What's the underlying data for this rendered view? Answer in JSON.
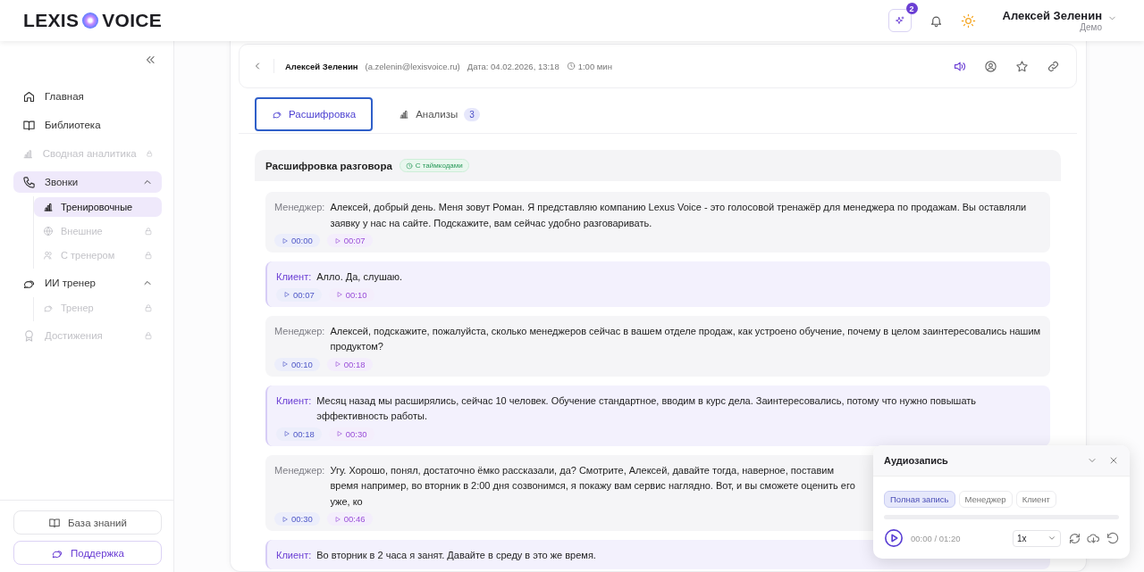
{
  "logo": {
    "left": "LEXIS",
    "right": "VOICE"
  },
  "header": {
    "ai_badge": "2",
    "user_name": "Алексей Зеленин",
    "user_role": "Демо"
  },
  "sidebar": {
    "items": [
      {
        "label": "Главная",
        "selected": false,
        "disabled": false,
        "locked": false
      },
      {
        "label": "Библиотека",
        "selected": false,
        "disabled": false,
        "locked": false
      },
      {
        "label": "Сводная аналитика",
        "selected": false,
        "disabled": true,
        "locked": true
      },
      {
        "label": "Звонки",
        "selected": true,
        "disabled": false,
        "locked": false,
        "expanded": true,
        "children": [
          {
            "label": "Тренировочные",
            "selected": true,
            "disabled": false,
            "locked": false
          },
          {
            "label": "Внешние",
            "selected": false,
            "disabled": true,
            "locked": true
          },
          {
            "label": "С тренером",
            "selected": false,
            "disabled": true,
            "locked": true
          }
        ]
      },
      {
        "label": "ИИ тренер",
        "selected": false,
        "disabled": false,
        "locked": false,
        "expanded": true,
        "children": [
          {
            "label": "Тренер",
            "selected": false,
            "disabled": true,
            "locked": true
          }
        ]
      },
      {
        "label": "Достижения",
        "selected": false,
        "disabled": true,
        "locked": true
      }
    ],
    "bottom_buttons": [
      {
        "label": "База знаний",
        "kind": "plain"
      },
      {
        "label": "Поддержка",
        "kind": "accent"
      }
    ]
  },
  "call": {
    "name": "Алексей Зеленин",
    "email": "(a.zelenin@lexisvoice.ru)",
    "date": "Дата: 04.02.2026, 13:18",
    "duration": "1:00 мин"
  },
  "tabs": [
    {
      "label": "Расшифровка",
      "selected": true
    },
    {
      "label": "Анализы",
      "count": "3",
      "selected": false
    }
  ],
  "transcript": {
    "title": "Расшифровка разговора",
    "badge": "С таймкодами",
    "messages": [
      {
        "kind": "manager",
        "speaker": "Менеджер:",
        "text": "Алексей, добрый день. Меня зовут Роман. Я представляю компанию Lexus Voice - это голосовой тренажёр для менеджера по продажам. Вы оставляли заявку у нас на сайте. Подскажите, вам сейчас удобно разговаривать.",
        "start": "00:00",
        "end": "00:07"
      },
      {
        "kind": "client",
        "speaker": "Клиент:",
        "text": "Алло. Да, слушаю.",
        "start": "00:07",
        "end": "00:10"
      },
      {
        "kind": "manager",
        "speaker": "Менеджер:",
        "text": "Алексей, подскажите, пожалуйста, сколько менеджеров сейчас в вашем отделе продаж, как устроено обучение, почему в целом заинтересовались нашим продуктом?",
        "start": "00:10",
        "end": "00:18"
      },
      {
        "kind": "client",
        "speaker": "Клиент:",
        "text": "Месяц назад мы расширялись, сейчас 10 человек. Обучение стандартное, вводим в курс дела. Заинтересовались, потому что нужно повышать эффективность работы.",
        "start": "00:18",
        "end": "00:30"
      },
      {
        "kind": "manager",
        "speaker": "Менеджер:",
        "text": "Угу. Хорошо, понял, достаточно ёмко рассказали, да? Смотрите, Алексей, давайте тогда, наверное, поставим время например, во вторник в 2:00 дня созвонимся, я покажу вам сервис наглядно. Вот, и вы сможете оценить его уже, ко",
        "start": "00:30",
        "end": "00:46"
      },
      {
        "kind": "client",
        "speaker": "Клиент:",
        "text": "Во вторник в 2 часа я занят. Давайте в среду в это же время."
      }
    ]
  },
  "audio": {
    "title": "Аудиозапись",
    "filters": [
      {
        "label": "Полная запись",
        "selected": true
      },
      {
        "label": "Менеджер",
        "selected": false
      },
      {
        "label": "Клиент",
        "selected": false
      }
    ],
    "level": 0,
    "time": "00:00 / 01:20",
    "speed": "1x"
  }
}
